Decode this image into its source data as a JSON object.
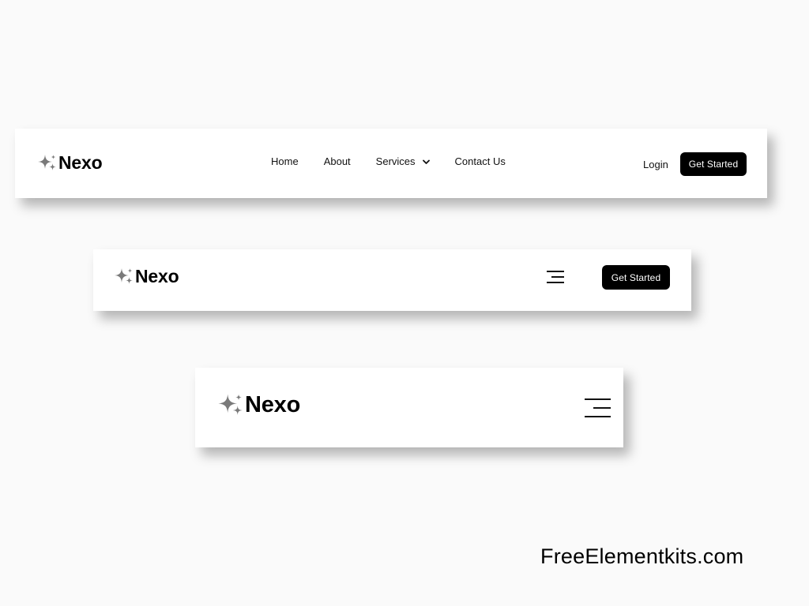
{
  "brand": {
    "name": "Nexo",
    "icon": "sparkle-icon",
    "icon_color": "#7a7a7a"
  },
  "desktop_nav": {
    "menu": [
      {
        "label": "Home"
      },
      {
        "label": "About"
      },
      {
        "label": "Services",
        "has_dropdown": true,
        "dropdown_icon": "chevron-down-icon"
      },
      {
        "label": "Contact Us"
      }
    ],
    "login_label": "Login",
    "cta_label": "Get Started"
  },
  "tablet_nav": {
    "menu_icon": "hamburger-menu-icon",
    "cta_label": "Get Started"
  },
  "mobile_nav": {
    "menu_icon": "hamburger-menu-icon"
  },
  "colors": {
    "background": "#fafafa",
    "navbar": "#ffffff",
    "cta_background": "#000000",
    "cta_text": "#ffffff"
  },
  "watermark": "FreeElementkits.com"
}
